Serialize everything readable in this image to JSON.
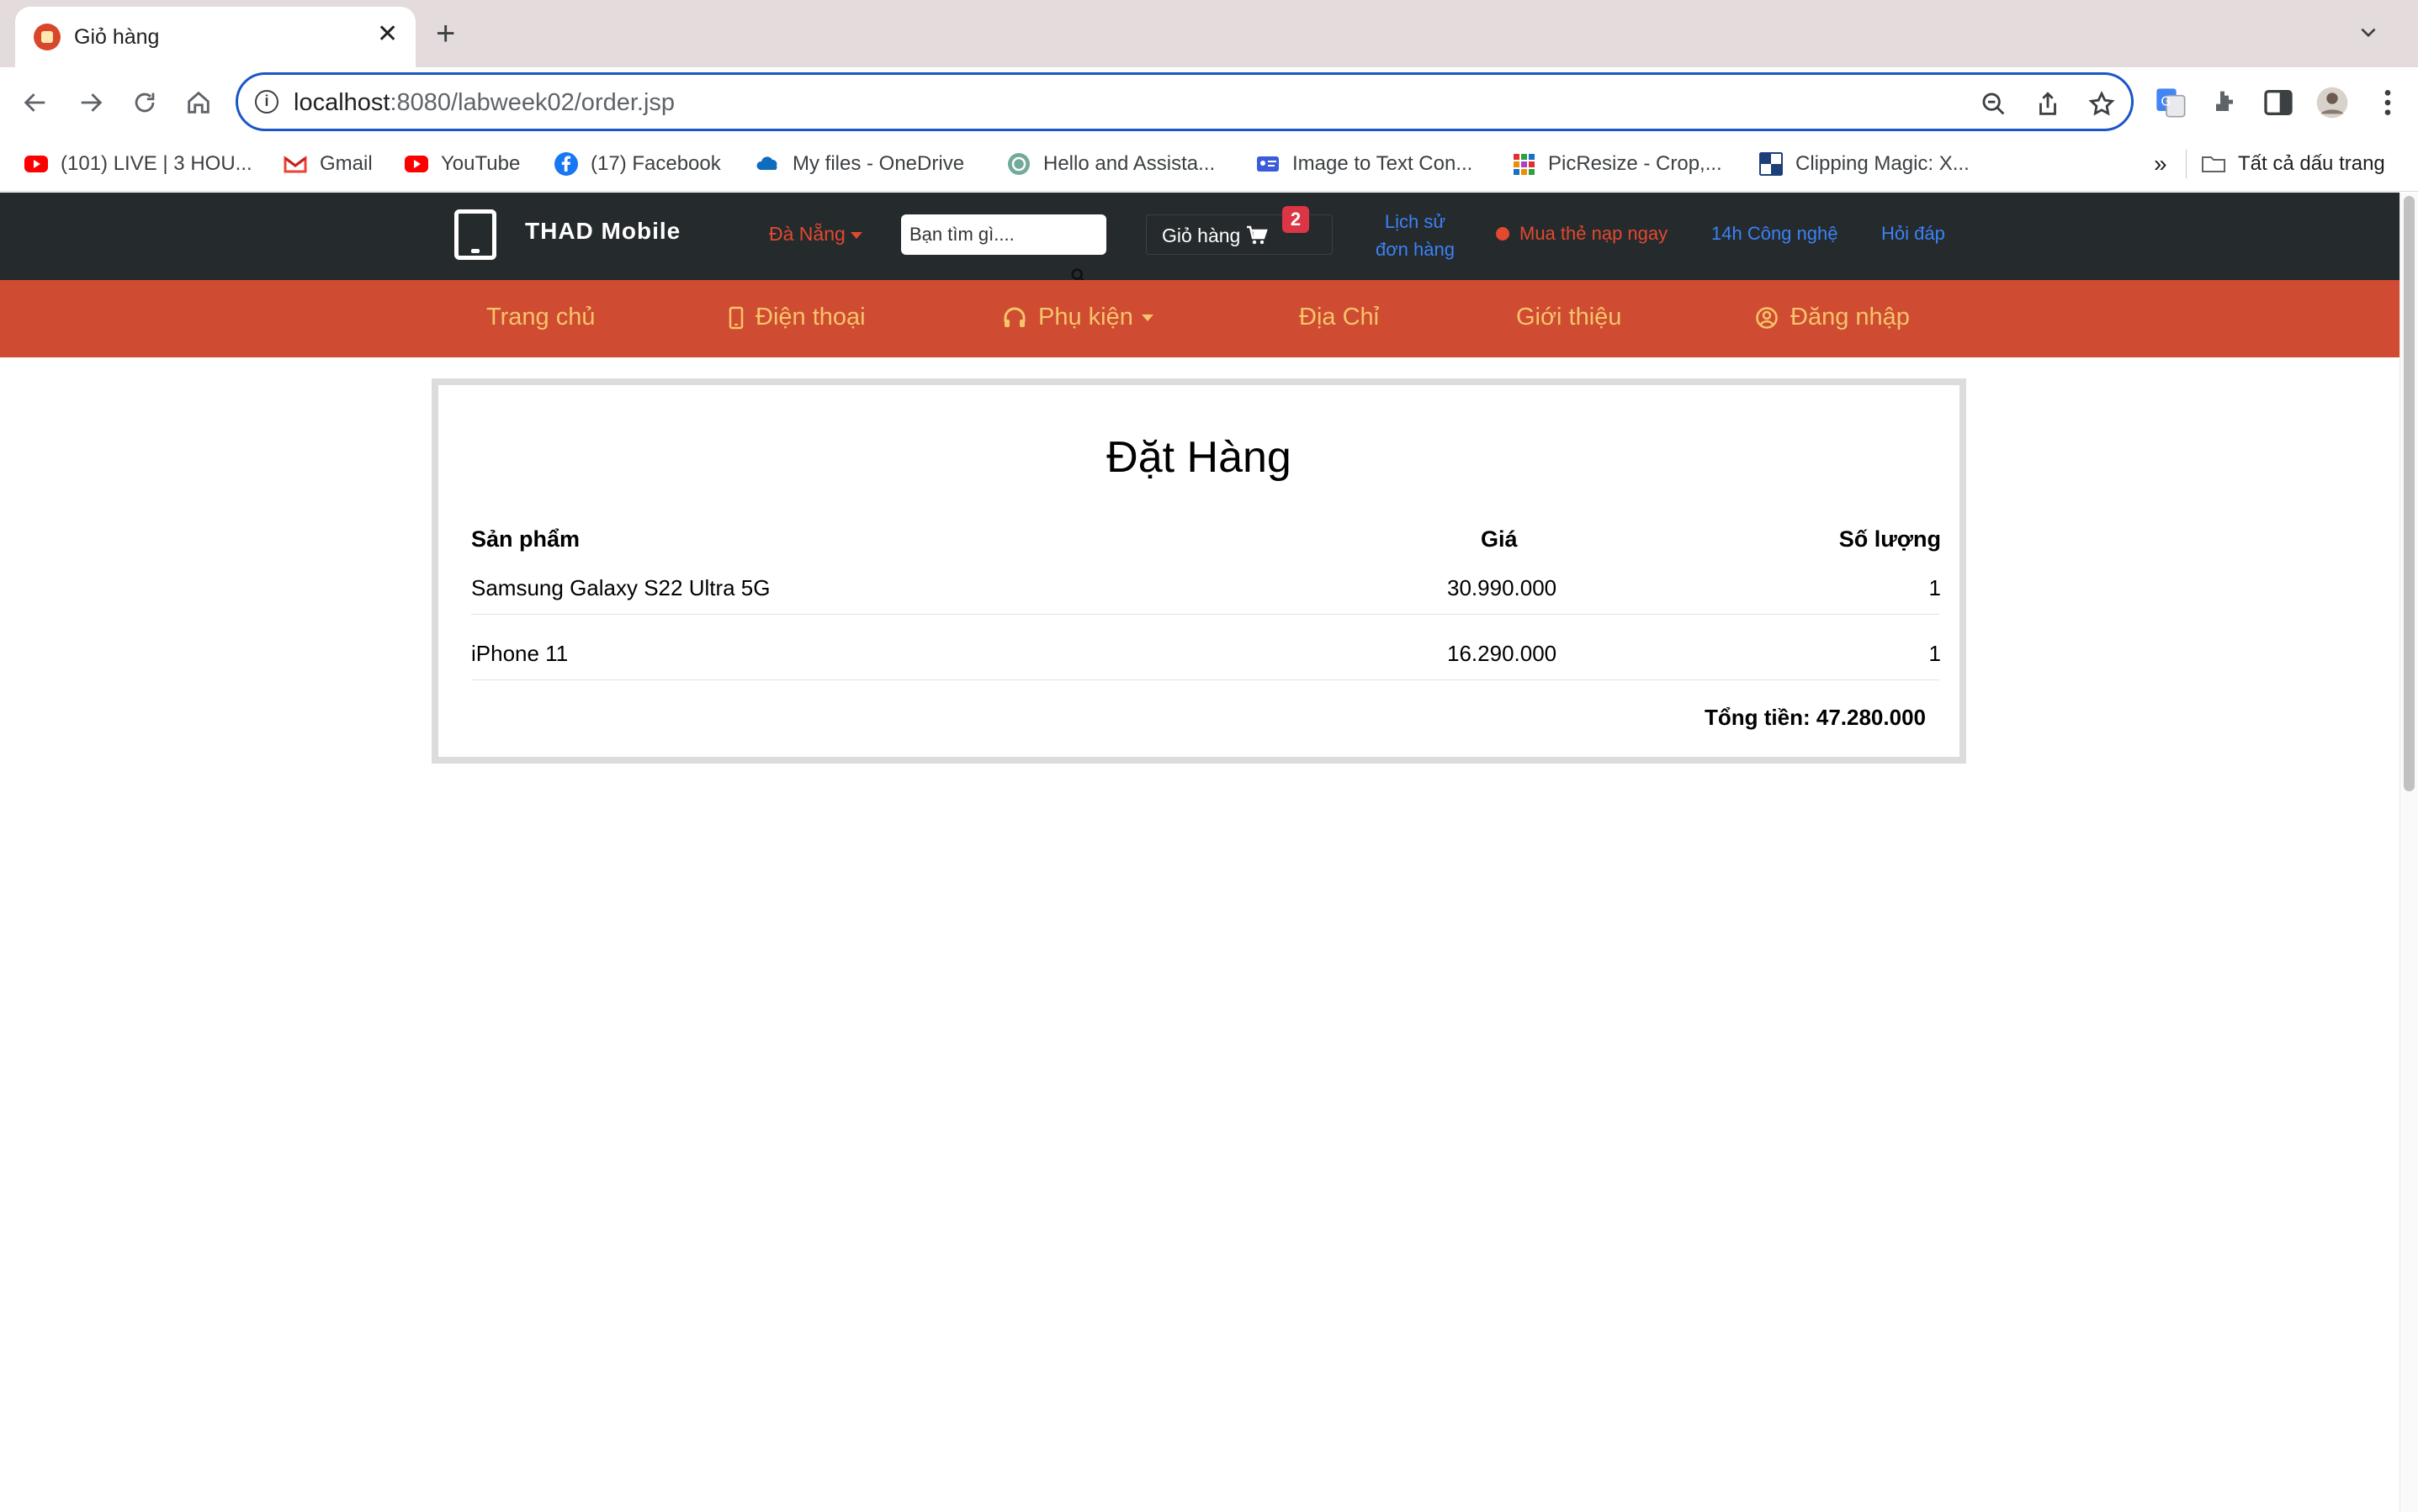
{
  "browser": {
    "tab_title": "Giỏ hàng",
    "new_tab": "+",
    "url_host": "localhost",
    "url_rest": ":8080/labweek02/order.jsp",
    "bookmarks": [
      {
        "label": "(101) LIVE | 3 HOU...",
        "icon": "youtube-icon"
      },
      {
        "label": "Gmail",
        "icon": "gmail-icon"
      },
      {
        "label": "YouTube",
        "icon": "youtube-icon"
      },
      {
        "label": "(17) Facebook",
        "icon": "facebook-icon"
      },
      {
        "label": "My files - OneDrive",
        "icon": "onedrive-icon"
      },
      {
        "label": "Hello and Assista...",
        "icon": "chatgpt-icon"
      },
      {
        "label": "Image to Text Con...",
        "icon": "id-card-icon"
      },
      {
        "label": "PicResize - Crop,...",
        "icon": "picresize-icon"
      },
      {
        "label": "Clipping Magic: X...",
        "icon": "clipping-magic-icon"
      }
    ],
    "bookmarks_more": "»",
    "all_bookmarks": "Tất cả dấu trang"
  },
  "site": {
    "logo": "THAD Mobile",
    "city": "Đà Nẵng",
    "search_placeholder": "Bạn tìm gì....",
    "cart_label": "Giỏ hàng",
    "cart_count": "2",
    "history_line1": "Lịch sử",
    "history_line2": "đơn hàng",
    "topup": "Mua thẻ nạp ngay",
    "tech_news": "14h Công nghệ",
    "faq": "Hỏi đáp",
    "nav": {
      "home": "Trang chủ",
      "phones": "Điện thoại",
      "accessories": "Phụ kiện",
      "address": "Địa Chỉ",
      "about": "Giới thiệu",
      "login": "Đăng nhập"
    }
  },
  "order": {
    "title": "Đặt Hàng",
    "columns": {
      "product": "Sản phẩm",
      "price": "Giá",
      "qty": "Số lượng"
    },
    "items": [
      {
        "product": "Samsung Galaxy S22 Ultra 5G",
        "price": "30.990.000",
        "qty": "1"
      },
      {
        "product": "iPhone 11",
        "price": "16.290.000",
        "qty": "1"
      }
    ],
    "total": "Tổng tiền: 47.280.000"
  },
  "colors": {
    "header_dark": "#252a2c",
    "nav_bar": "#cf4b32",
    "nav_text": "#f6c46a",
    "accent_red": "#e2492f",
    "link_blue": "#3b82f6",
    "badge_red": "#dc3545"
  }
}
